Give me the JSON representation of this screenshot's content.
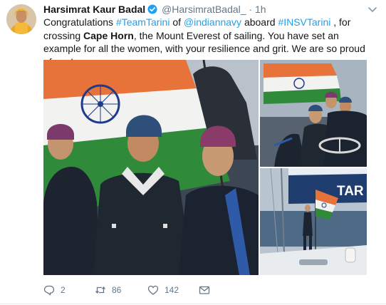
{
  "author": {
    "name": "Harsimrat Kaur Badal",
    "handle": "@HarsimratBadal_",
    "separator": "·",
    "time": "1h"
  },
  "text": {
    "part1": "Congratulations ",
    "hashtag_team": "#TeamTarini",
    "part2": " of ",
    "mention_navy": "@indiannavy",
    "part3": " aboard ",
    "hashtag_insv": "#INSVTarini",
    "part4": " , for crossing ",
    "bold_cape": "Cape Horn",
    "part5": ", the Mount Everest of sailing. You have set an example for all the women, with your resilience and grit. We are so proud of you!"
  },
  "media": {
    "sail_text": "TAR"
  },
  "actions": {
    "reply_count": "2",
    "retweet_count": "86",
    "like_count": "142"
  },
  "icons": {
    "verified": "verified-badge-icon",
    "caret": "chevron-down-icon",
    "reply": "reply-icon",
    "retweet": "retweet-icon",
    "like": "heart-icon",
    "dm": "envelope-icon"
  },
  "colors": {
    "link": "#1da1f2",
    "muted": "#657786",
    "text": "#14171a",
    "verified": "#1da1f2"
  }
}
